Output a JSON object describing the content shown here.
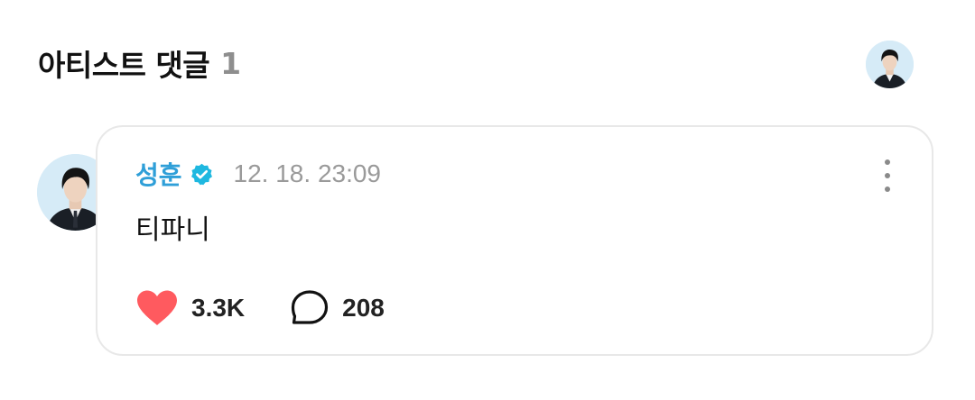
{
  "section": {
    "title": "아티스트 댓글",
    "count": "1"
  },
  "colors": {
    "author_name": "#2f9fd8",
    "verified_badge": "#1fb8e0",
    "like_heart": "#ff5a5f",
    "timestamp": "#9a9a9a"
  },
  "comment": {
    "author": "성훈",
    "verified_icon": "verified-badge-icon",
    "timestamp": "12. 18. 23:09",
    "text": "티파니",
    "likes": "3.3K",
    "replies": "208",
    "like_icon": "heart-icon",
    "reply_icon": "speech-bubble-icon",
    "more_icon": "more-vertical-icon"
  }
}
